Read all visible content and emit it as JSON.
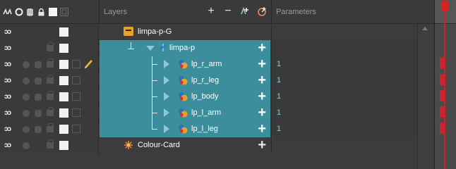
{
  "header": {
    "layers_label": "Layers",
    "parameters_label": "Parameters",
    "icons": [
      "animate-icon",
      "visibility-dot-icon",
      "database-icon",
      "lock-icon",
      "color-swatch-icon",
      "thumbnail-icon"
    ],
    "tools": {
      "add": "+",
      "remove": "−"
    }
  },
  "layers": [
    {
      "name": "limpa-p-G",
      "type": "group",
      "param": "",
      "selected": false,
      "pencil": false
    },
    {
      "name": "limpa-p",
      "type": "peg",
      "param": "",
      "selected": true,
      "pencil": false
    },
    {
      "name": "lp_r_arm",
      "type": "drawing",
      "param": "1",
      "selected": true,
      "pencil": true
    },
    {
      "name": "lp_r_leg",
      "type": "drawing",
      "param": "1",
      "selected": true,
      "pencil": false
    },
    {
      "name": "lp_body",
      "type": "drawing",
      "param": "1",
      "selected": true,
      "pencil": false
    },
    {
      "name": "lp_l_arm",
      "type": "drawing",
      "param": "1",
      "selected": true,
      "pencil": false
    },
    {
      "name": "lp_l_leg",
      "type": "drawing",
      "param": "1",
      "selected": true,
      "pencil": false
    },
    {
      "name": "Colour-Card",
      "type": "colour-card",
      "param": "",
      "selected": false,
      "pencil": false
    }
  ],
  "row_controls": {
    "visible_glyph": "ɔɔ"
  },
  "colors": {
    "selected_row": "#3c8e9c",
    "panel_bg": "#3c3c3c",
    "keyframe": "#cc2233",
    "playhead": "#d02020"
  }
}
